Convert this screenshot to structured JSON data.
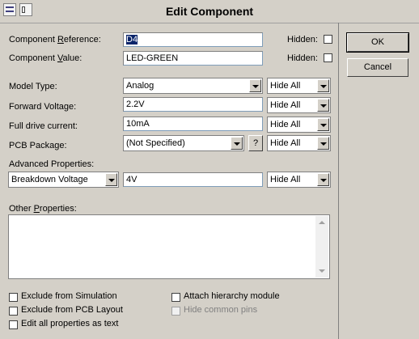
{
  "window": {
    "title": "Edit Component"
  },
  "component_reference": {
    "label": "Component Reference:",
    "value": "D4",
    "hidden_label": "Hidden:"
  },
  "component_value": {
    "label": "Component Value:",
    "value": "LED-GREEN",
    "hidden_label": "Hidden:"
  },
  "model_type": {
    "label": "Model Type:",
    "value": "Analog",
    "visibility": "Hide All"
  },
  "forward_voltage": {
    "label": "Forward Voltage:",
    "value": "2.2V",
    "visibility": "Hide All"
  },
  "full_drive_current": {
    "label": "Full drive current:",
    "value": "10mA",
    "visibility": "Hide All"
  },
  "pcb_package": {
    "label": "PCB Package:",
    "value": "(Not Specified)",
    "help": "?",
    "visibility": "Hide All"
  },
  "advanced_properties": {
    "label": "Advanced Properties:",
    "property": "Breakdown Voltage",
    "value": "4V",
    "visibility": "Hide All"
  },
  "other_properties": {
    "label": "Other Properties:",
    "value": ""
  },
  "checkboxes": {
    "exclude_simulation": "Exclude from Simulation",
    "exclude_pcb": "Exclude from PCB Layout",
    "edit_as_text": "Edit all properties as text",
    "attach_hierarchy": "Attach hierarchy module",
    "hide_common_pins": "Hide common pins"
  },
  "buttons": {
    "ok": "OK",
    "cancel": "Cancel"
  }
}
